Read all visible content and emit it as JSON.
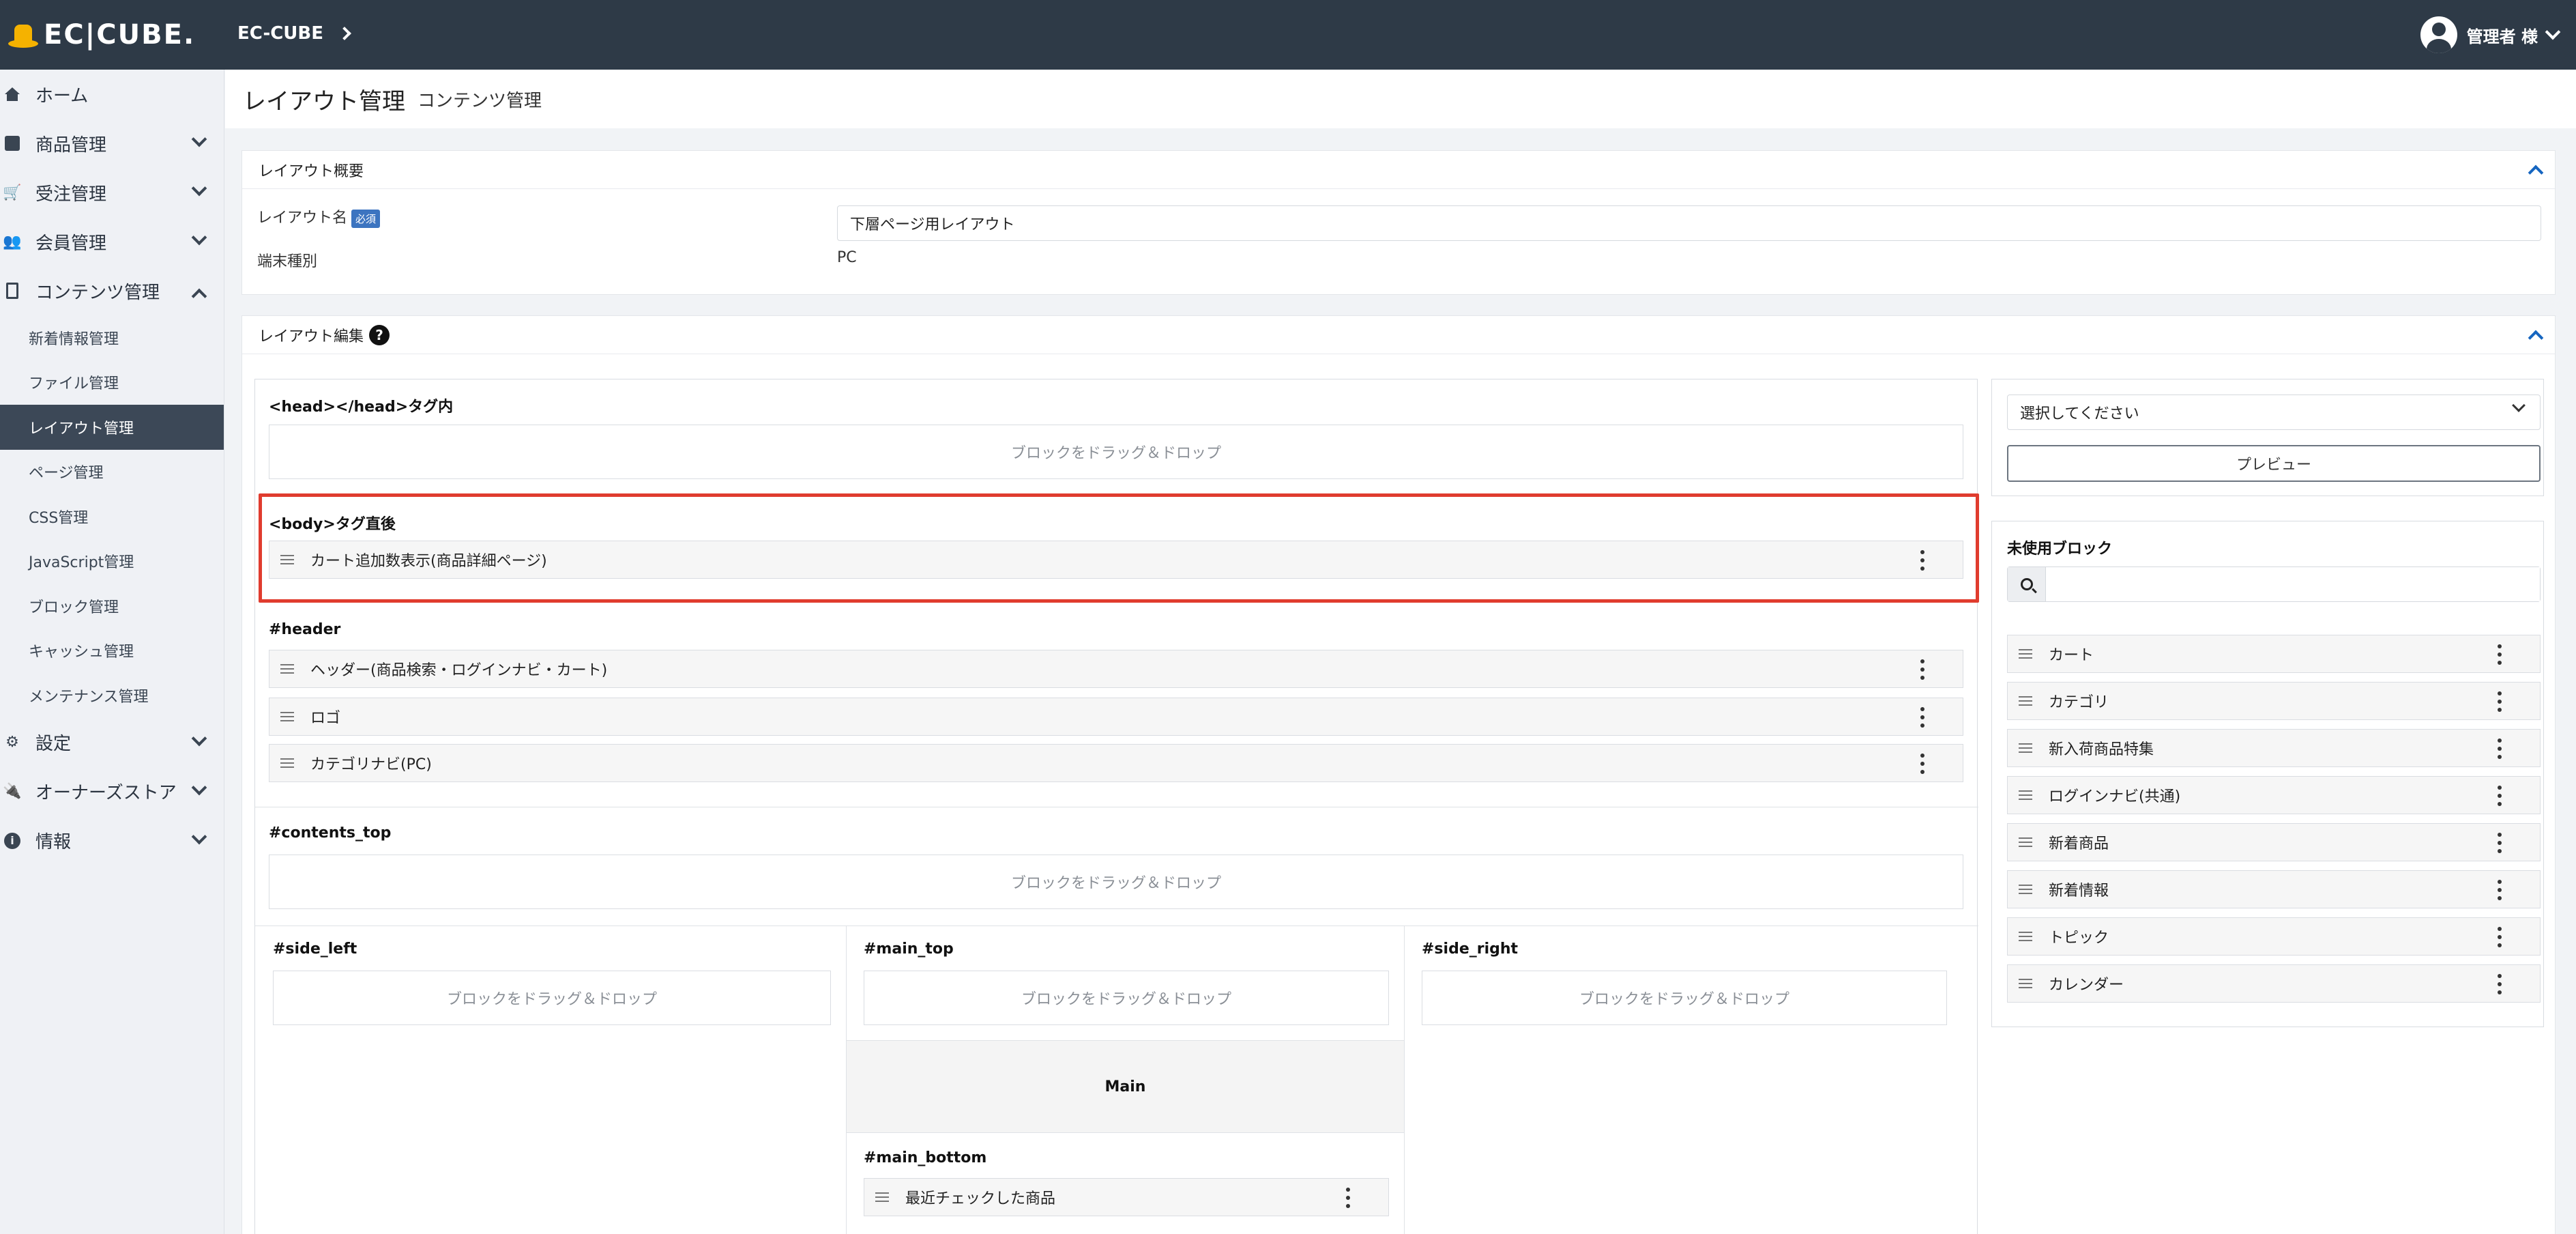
{
  "header": {
    "logo_text": "EC|CUBE.",
    "shop_name": "EC-CUBE",
    "user_name": "管理者 様"
  },
  "sidebar": {
    "items": [
      {
        "label": "ホーム",
        "icon": "home-icon"
      },
      {
        "label": "商品管理",
        "icon": "box-icon"
      },
      {
        "label": "受注管理",
        "icon": "cart-icon"
      },
      {
        "label": "会員管理",
        "icon": "users-icon"
      },
      {
        "label": "コンテンツ管理",
        "icon": "document-icon"
      }
    ],
    "sub_items": [
      {
        "label": "新着情報管理"
      },
      {
        "label": "ファイル管理"
      },
      {
        "label": "レイアウト管理",
        "active": true
      },
      {
        "label": "ページ管理"
      },
      {
        "label": "CSS管理"
      },
      {
        "label": "JavaScript管理"
      },
      {
        "label": "ブロック管理"
      },
      {
        "label": "キャッシュ管理"
      },
      {
        "label": "メンテナンス管理"
      }
    ],
    "bottom_items": [
      {
        "label": "設定",
        "icon": "gear-icon"
      },
      {
        "label": "オーナーズストア",
        "icon": "plug-icon"
      },
      {
        "label": "情報",
        "icon": "info-icon"
      }
    ]
  },
  "page": {
    "title": "レイアウト管理",
    "subtitle": "コンテンツ管理"
  },
  "overview": {
    "heading": "レイアウト概要",
    "name_label": "レイアウト名",
    "required_badge": "必須",
    "name_value": "下層ページ用レイアウト",
    "device_label": "端末種別",
    "device_value": "PC"
  },
  "editor": {
    "heading": "レイアウト編集",
    "drop_text": "ブロックをドラッグ＆ドロップ",
    "regions": {
      "head": "<head></head>タグ内",
      "body_after": "<body>タグ直後",
      "header": "#header",
      "contents_top": "#contents_top",
      "side_left": "#side_left",
      "main_top": "#main_top",
      "side_right": "#side_right",
      "main": "Main",
      "main_bottom": "#main_bottom"
    },
    "body_after_blocks": [
      "カート追加数表示(商品詳細ページ)"
    ],
    "header_blocks": [
      "ヘッダー(商品検索・ログインナビ・カート)",
      "ロゴ",
      "カテゴリナビ(PC)"
    ],
    "main_bottom_blocks": [
      "最近チェックした商品"
    ]
  },
  "right_panel": {
    "select_value": "選択してください",
    "preview_button": "プレビュー",
    "unused_heading": "未使用ブロック",
    "search_placeholder": "",
    "unused_blocks": [
      "カート",
      "カテゴリ",
      "新入荷商品特集",
      "ログインナビ(共通)",
      "新着商品",
      "新着情報",
      "トピック",
      "カレンダー"
    ]
  },
  "colors": {
    "topbar": "#2e3a47",
    "sidebar_active": "#3c4857",
    "highlight": "#e03c2e",
    "required_badge": "#3c74c0",
    "accent": "#1565c0"
  }
}
